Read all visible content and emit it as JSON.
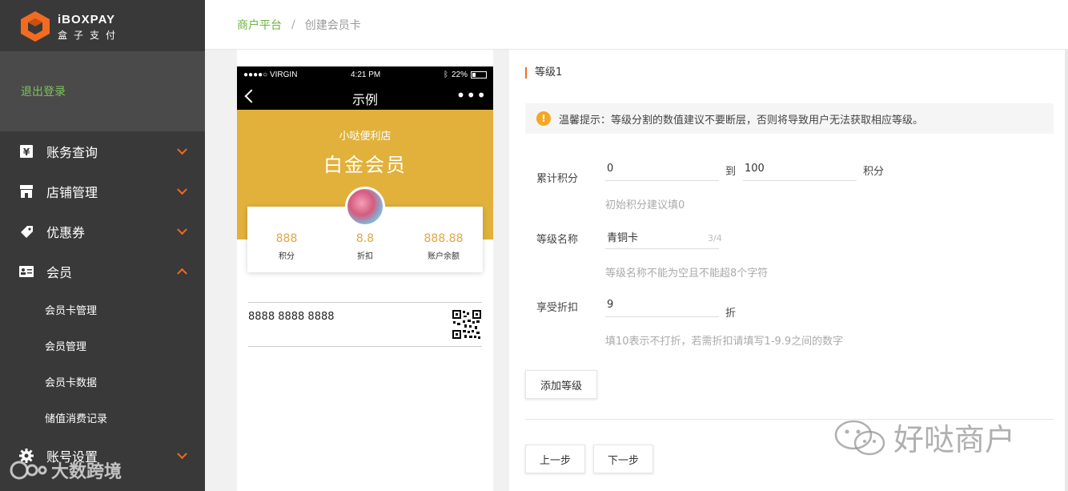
{
  "brand": {
    "name_en": "iBOXPAY",
    "name_cn": "盒子支付"
  },
  "sidebar": {
    "logout_label": "退出登录",
    "menu": [
      {
        "label": "账务查询"
      },
      {
        "label": "店铺管理"
      },
      {
        "label": "优惠券"
      },
      {
        "label": "会员"
      },
      {
        "label": "账号设置"
      }
    ],
    "member_subitems": [
      "会员卡管理",
      "会员管理",
      "会员卡数据",
      "储值消费记录"
    ]
  },
  "breadcrumb": {
    "home": "商户平台",
    "separator": "/",
    "current": "创建会员卡"
  },
  "phone": {
    "status": {
      "carrier": "●●●●○ VIRGIN",
      "time": "4:21 PM",
      "battery": "22%"
    },
    "nav_title": "示例",
    "more": "•••",
    "store_name": "小哒便利店",
    "level_name": "白金会员",
    "stats": [
      {
        "value": "888",
        "label": "积分"
      },
      {
        "value": "8.8",
        "label": "折扣"
      },
      {
        "value": "888.88",
        "label": "账户余额"
      }
    ],
    "card_number": "8888 8888 8888",
    "card_color": "#e1b13c"
  },
  "form": {
    "level_title": "等级1",
    "notice": "温馨提示：等级分割的数值建议不要断层，否则将导致用户无法获取相应等级。",
    "points": {
      "label": "累计积分",
      "from": "0",
      "to_word": "到",
      "to": "100",
      "unit": "积分",
      "hint": "初始积分建议填0"
    },
    "level_name": {
      "label": "等级名称",
      "value": "青铜卡",
      "counter": "3/4",
      "hint": "等级名称不能为空且不能超8个字符"
    },
    "discount": {
      "label": "享受折扣",
      "value": "9",
      "unit": "折",
      "hint": "填10表示不打折，若需折扣请填写1-9.9之间的数字"
    },
    "add_level_button": "添加等级",
    "prev_button": "上一步",
    "next_button": "下一步"
  },
  "watermarks": {
    "right": "好哒商户",
    "left": "大数跨境"
  },
  "colors": {
    "accent_orange": "#f26b21",
    "link_green": "#6cb33e",
    "sidebar_bg": "#393939"
  }
}
